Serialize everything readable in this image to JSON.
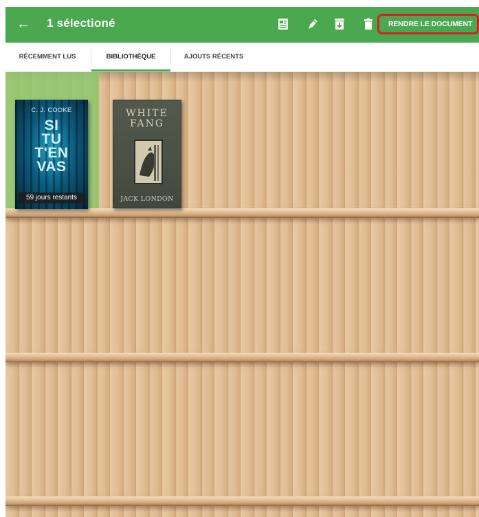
{
  "app_bar": {
    "title": "1 sélectioné",
    "return_button_label": "RENDRE LE DOCUMENT",
    "color": "#4aa84f",
    "highlight_color": "#d91f26",
    "actions": [
      {
        "icon": "book-details-icon"
      },
      {
        "icon": "pencil-icon"
      },
      {
        "icon": "archive-icon"
      },
      {
        "icon": "trash-icon"
      }
    ]
  },
  "tabs": [
    {
      "label": "RÉCEMMENT LUS",
      "active": false
    },
    {
      "label": "BIBLIOTHÈQUE",
      "active": true
    },
    {
      "label": "AJOUTS RÉCENTS",
      "active": false
    }
  ],
  "books": [
    {
      "author": "C. J. COOKE",
      "title_lines": [
        "SI",
        "TU",
        "T'EN",
        "VAS"
      ],
      "badge": "59 jours restants",
      "selected": true
    },
    {
      "title_lines": [
        "WHITE",
        "FANG"
      ],
      "author": "JACK LONDON",
      "selected": false
    }
  ]
}
